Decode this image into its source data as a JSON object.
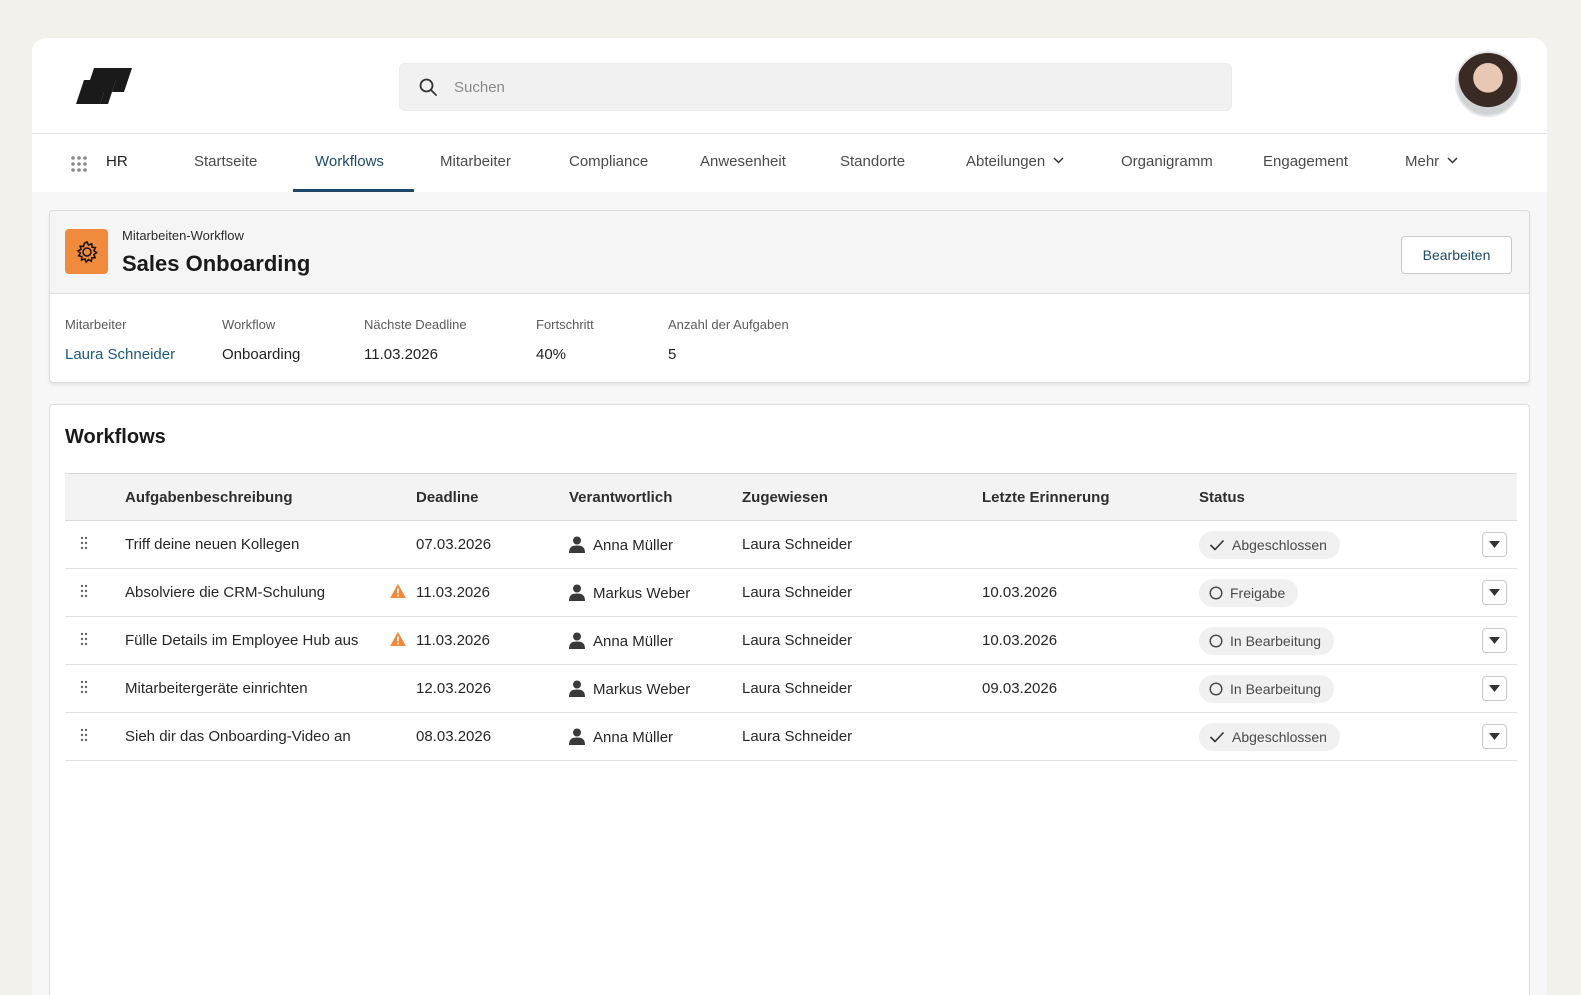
{
  "header": {
    "search_placeholder": "Suchen"
  },
  "nav": {
    "app_name": "HR",
    "items": [
      {
        "label": "Startseite"
      },
      {
        "label": "Workflows",
        "active": true
      },
      {
        "label": "Mitarbeiter"
      },
      {
        "label": "Compliance"
      },
      {
        "label": "Anwesenheit"
      },
      {
        "label": "Standorte"
      },
      {
        "label": "Abteilungen",
        "dropdown": true
      },
      {
        "label": "Organigramm"
      },
      {
        "label": "Engagement"
      },
      {
        "label": "Mehr",
        "dropdown": true
      }
    ]
  },
  "record": {
    "type_label": "Mitarbeiten-Workflow",
    "title": "Sales Onboarding",
    "edit_label": "Bearbeiten",
    "icon": "gear-icon",
    "icon_color": "#f08a3c",
    "fields": [
      {
        "label": "Mitarbeiter",
        "value": "Laura Schneider"
      },
      {
        "label": "Workflow",
        "value": "Onboarding"
      },
      {
        "label": "Nächste Deadline",
        "value": "11.03.2026"
      },
      {
        "label": "Fortschritt",
        "value": "40%"
      },
      {
        "label": "Anzahl der Aufgaben",
        "value": "5"
      }
    ]
  },
  "workflows": {
    "title": "Workflows",
    "columns": [
      "Aufgabenbeschreibung",
      "Deadline",
      "Verantwortlich",
      "Zugewiesen",
      "Letzte Erinnerung",
      "Status"
    ],
    "rows": [
      {
        "desc": "Triff deine neuen Kollegen",
        "warning": false,
        "deadline": "07.03.2026",
        "responsible": "Anna Müller",
        "assigned": "Laura Schneider",
        "reminder": "",
        "status": "Abgeschlossen",
        "status_icon": "check-icon"
      },
      {
        "desc": "Absolviere die CRM-Schulung",
        "warning": true,
        "deadline": "11.03.2026",
        "responsible": "Markus Weber",
        "assigned": "Laura Schneider",
        "reminder": "10.03.2026",
        "status": "Freigabe",
        "status_icon": "circle-icon"
      },
      {
        "desc": "Fülle Details im Employee Hub aus",
        "warning": true,
        "deadline": "11.03.2026",
        "responsible": "Anna Müller",
        "assigned": "Laura Schneider",
        "reminder": "10.03.2026",
        "status": "In Bearbeitung",
        "status_icon": "circle-icon"
      },
      {
        "desc": "Mitarbeitergeräte einrichten",
        "warning": false,
        "deadline": "12.03.2026",
        "responsible": "Markus Weber",
        "assigned": "Laura Schneider",
        "reminder": "09.03.2026",
        "status": "In Bearbeitung",
        "status_icon": "circle-icon"
      },
      {
        "desc": "Sieh dir das Onboarding-Video an",
        "warning": false,
        "deadline": "08.03.2026",
        "responsible": "Anna Müller",
        "assigned": "Laura Schneider",
        "reminder": "",
        "status": "Abgeschlossen",
        "status_icon": "check-icon"
      }
    ]
  },
  "colors": {
    "accent": "#1d4a6b",
    "warning": "#f08a3c"
  }
}
